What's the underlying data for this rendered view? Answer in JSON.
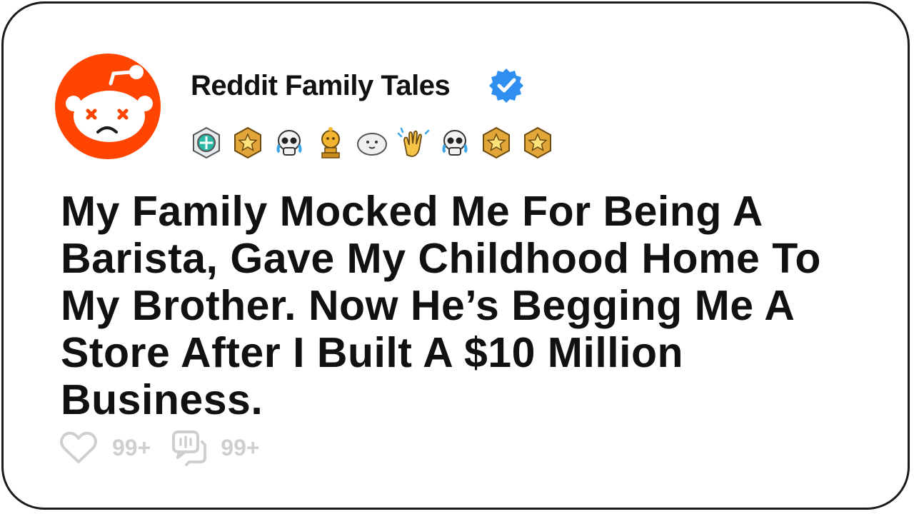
{
  "post": {
    "channel_name": "Reddit Family Tales",
    "verified_icon": "verified-badge-icon",
    "avatar_icon": "reddit-snoo-sad-icon",
    "awards": [
      "silver-medal-award-icon",
      "gold-star-award-icon",
      "crying-skull-award-icon",
      "gold-snoo-trophy-award-icon",
      "seal-award-icon",
      "clapping-hands-award-icon",
      "crying-skull-award-icon",
      "gold-star-award-icon",
      "gold-star-award-icon"
    ],
    "headline": "My Family Mocked Me For Being A Barista, Gave My Childhood Home To My Brother. Now He’s Begging Me A Store After I Built A $10 Million Business.",
    "likes": "99+",
    "comments": "99+"
  },
  "colors": {
    "brand": "#ff4500",
    "verified": "#2f8ff0",
    "text": "#111111",
    "muted": "#cfcfcf",
    "border": "#1b1b1b"
  }
}
